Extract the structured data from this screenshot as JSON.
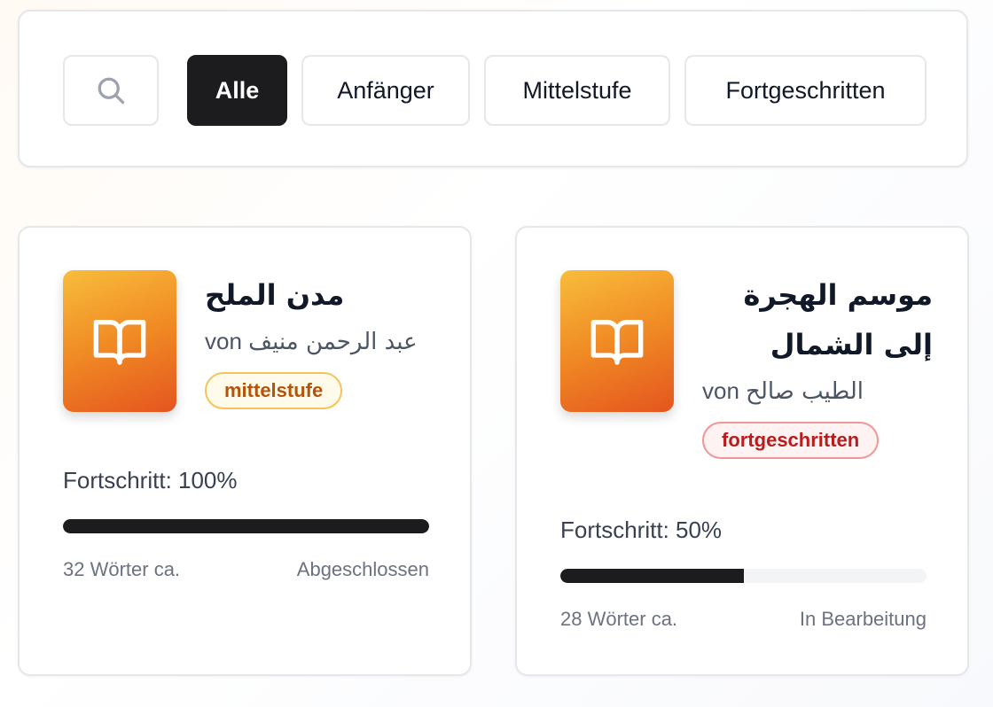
{
  "filters": {
    "search_icon": "search-icon",
    "options": [
      {
        "label": "Alle",
        "active": true
      },
      {
        "label": "Anfänger",
        "active": false
      },
      {
        "label": "Mittelstufe",
        "active": false
      },
      {
        "label": "Fortgeschritten",
        "active": false
      }
    ]
  },
  "books": [
    {
      "title": "مدن الملح",
      "author_prefix": "von",
      "author": "عبد الرحمن منيف",
      "level": "mittelstufe",
      "progress_text": "Fortschritt: 100%",
      "progress": 100,
      "words": "32 Wörter ca.",
      "status": "Abgeschlossen",
      "cover_icon": "book-open-icon"
    },
    {
      "title": "موسم الهجرة إلى الشمال",
      "author_prefix": "von",
      "author": "الطيب صالح",
      "level": "fortgeschritten",
      "progress_text": "Fortschritt: 50%",
      "progress": 50,
      "words": "28 Wörter ca.",
      "status": "In Bearbeitung",
      "cover_icon": "book-open-icon"
    }
  ],
  "colors": {
    "active_pill": "#1c1c1e",
    "progress_fill": "#1c1c1e",
    "cover_gradient_start": "#f8bd3c",
    "cover_gradient_end": "#e4551f",
    "badge_mid_text": "#b45309",
    "badge_adv_text": "#b91c1c"
  }
}
